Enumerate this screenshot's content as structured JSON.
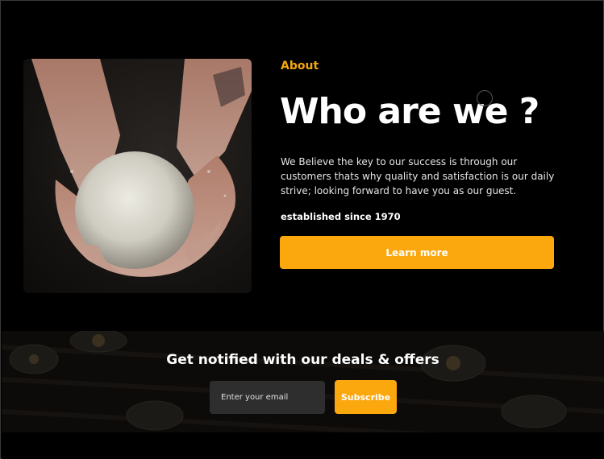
{
  "about": {
    "label": "About",
    "title": "Who are we ?",
    "description": "We Believe the key to our success is through our customers thats why quality and satisfaction is our daily strive; looking forward to have you as our guest.",
    "established": "established since 1970",
    "cta_label": "Learn more",
    "image": "chef-holding-dough-photo"
  },
  "newsletter": {
    "title": "Get notified with our deals & offers",
    "email_placeholder": "Enter your email",
    "subscribe_label": "Subscribe",
    "background": "restaurant-tables-photo"
  },
  "colors": {
    "accent": "#fba70e",
    "label": "#f5a70d",
    "background": "#000000",
    "input": "#2e2e2e"
  }
}
